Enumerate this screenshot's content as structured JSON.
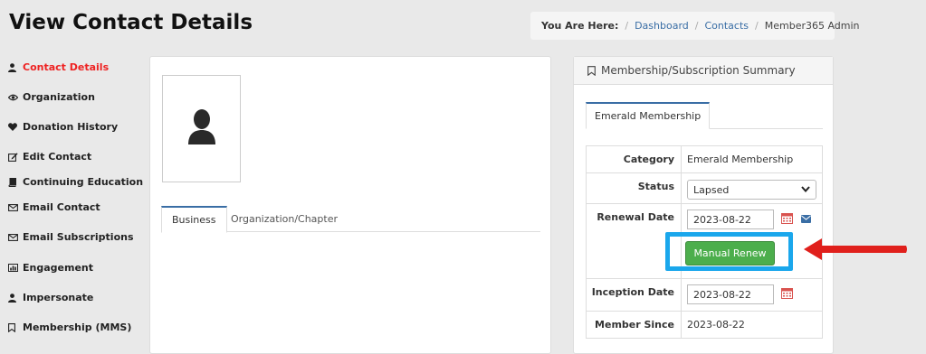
{
  "page": {
    "title": "View Contact Details"
  },
  "breadcrumb": {
    "prefix": "You Are Here:",
    "items": [
      "Dashboard",
      "Contacts",
      "Member365 Admin"
    ]
  },
  "sidebar": {
    "items": [
      {
        "label": "Contact Details",
        "icon": "user-icon",
        "active": true
      },
      {
        "label": "Organization",
        "icon": "eye-icon"
      },
      {
        "label": "Donation History",
        "icon": "heart-icon"
      },
      {
        "label": "Edit Contact",
        "icon": "edit-icon"
      },
      {
        "label": "Continuing Education",
        "icon": "book-icon"
      },
      {
        "label": "Email Contact",
        "icon": "envelope-icon"
      },
      {
        "label": "Email Subscriptions",
        "icon": "envelope-icon"
      },
      {
        "label": "Engagement",
        "icon": "bar-chart-icon"
      },
      {
        "label": "Impersonate",
        "icon": "user-icon"
      },
      {
        "label": "Membership (MMS)",
        "icon": "bookmark-icon"
      }
    ]
  },
  "contact_panel": {
    "tabs": [
      "Business",
      "Organization/Chapter"
    ],
    "active_tab": "Business"
  },
  "membership_panel": {
    "title": "Membership/Subscription Summary",
    "tab": "Emerald Membership",
    "fields": {
      "category_label": "Category",
      "category_value": "Emerald Membership",
      "status_label": "Status",
      "status_value": "Lapsed",
      "renewal_label": "Renewal Date",
      "renewal_value": "2023-08-22",
      "inception_label": "Inception Date",
      "inception_value": "2023-08-22",
      "member_since_label": "Member Since",
      "member_since_value": "2023-08-22"
    },
    "renew_button": "Manual Renew"
  },
  "colors": {
    "accent": "#3a6ea5",
    "active_nav": "#e22222",
    "renew_button": "#4cae4c",
    "highlight": "#1aa7ec",
    "arrow": "#e0201c"
  }
}
